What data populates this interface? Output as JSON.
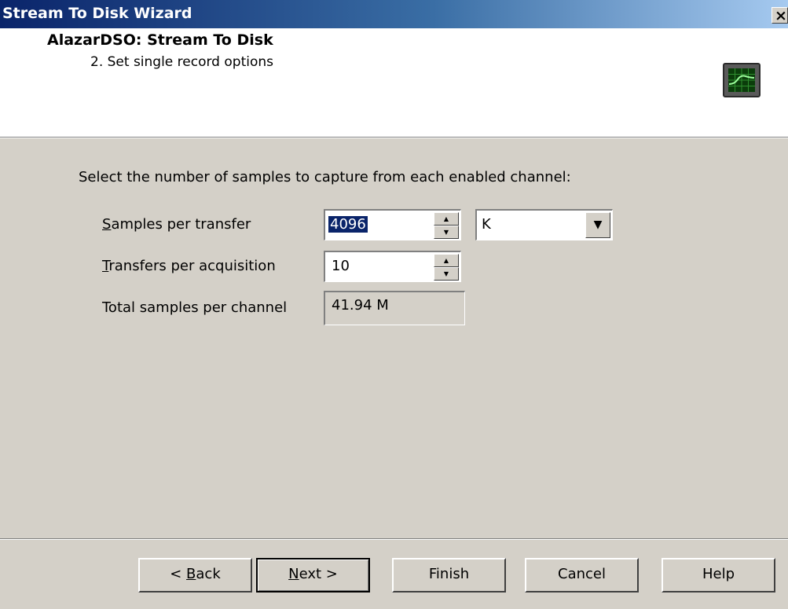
{
  "window": {
    "title": "Stream To Disk Wizard",
    "close_glyph": "×"
  },
  "header": {
    "title": "AlazarDSO: Stream To Disk",
    "subtitle": "2. Set single record options",
    "icon": "oscilloscope-icon"
  },
  "instruction": "Select the number of samples to capture from each enabled channel:",
  "fields": {
    "samples_per_transfer": {
      "label_mnemonic": "S",
      "label_rest": "amples per transfer",
      "value": "4096",
      "unit_value": "K"
    },
    "transfers_per_acquisition": {
      "label_mnemonic": "T",
      "label_rest": "ransfers per acquisition",
      "value": "10"
    },
    "total_samples": {
      "label": "Total samples per channel",
      "value": "41.94 M"
    }
  },
  "buttons": {
    "back": {
      "pre": "< ",
      "mnemonic": "B",
      "rest": "ack"
    },
    "next": {
      "mnemonic": "N",
      "rest": "ext >"
    },
    "finish": "Finish",
    "cancel": "Cancel",
    "help": "Help"
  },
  "colors": {
    "title_bar_start": "#0a246a",
    "title_bar_end": "#a6caf0",
    "dialog_bg": "#d4d0c8",
    "selection": "#0a246a"
  }
}
